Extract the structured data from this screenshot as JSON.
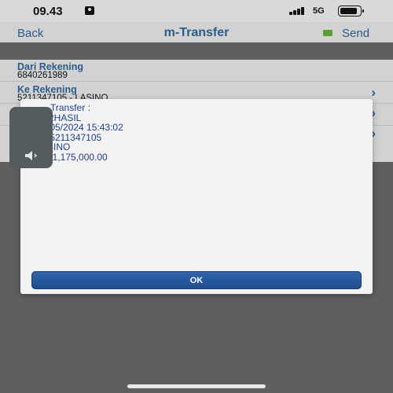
{
  "status_bar": {
    "time": "09.43",
    "network": "5G"
  },
  "nav": {
    "back_label": "Back",
    "title": "m-Transfer",
    "send_label": "Send"
  },
  "form": {
    "rows": [
      {
        "label": "Dari Rekening",
        "value": "6840261989"
      },
      {
        "label": "Ke Rekening",
        "value": "5211347105 - LASINO"
      }
    ]
  },
  "modal": {
    "lines": [
      "-Transfer :",
      "RHASIL",
      "/05/2024 15:43:02",
      " 5211347105",
      "SINO",
      ". 1,175,000.00"
    ],
    "ok_label": "OK"
  },
  "colors": {
    "brand_blue": "#2b5c8a",
    "send_green": "#5aa02c",
    "button_blue": "#2f66ad"
  },
  "icons": {
    "status_person": "person-badge-icon",
    "signal": "cellular-signal-icon",
    "battery": "battery-icon",
    "send": "send-icon",
    "chevron": "chevron-right-icon",
    "volume": "speaker-icon"
  }
}
